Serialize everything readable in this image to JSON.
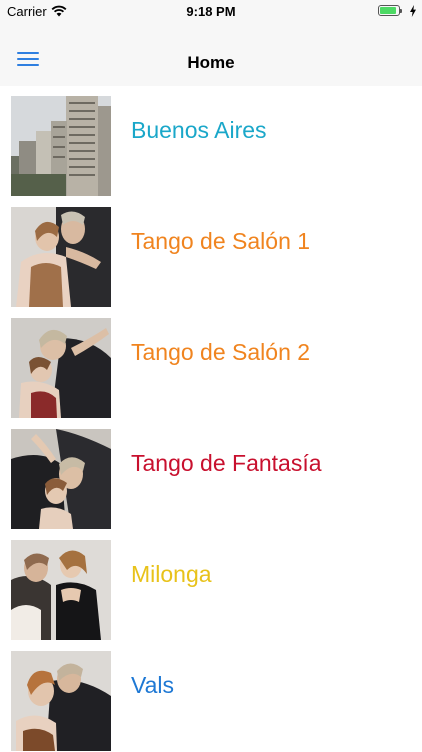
{
  "status": {
    "carrier": "Carrier",
    "time": "9:18 PM",
    "battery_level": 0.9
  },
  "nav": {
    "title": "Home",
    "menu_icon": "hamburger-menu-icon"
  },
  "items": [
    {
      "label": "Buenos Aires",
      "color": "#1aa7c9",
      "image": "city-skyline-photo"
    },
    {
      "label": "Tango de Salón 1",
      "color": "#f0841f",
      "image": "tango-couple-photo"
    },
    {
      "label": "Tango de Salón 2",
      "color": "#f0841f",
      "image": "tango-couple-photo"
    },
    {
      "label": "Tango de Fantasía",
      "color": "#c8102e",
      "image": "tango-couple-photo"
    },
    {
      "label": "Milonga",
      "color": "#e8c21a",
      "image": "dancing-couple-photo"
    },
    {
      "label": "Vals",
      "color": "#1e78d4",
      "image": "waltz-couple-photo"
    }
  ]
}
